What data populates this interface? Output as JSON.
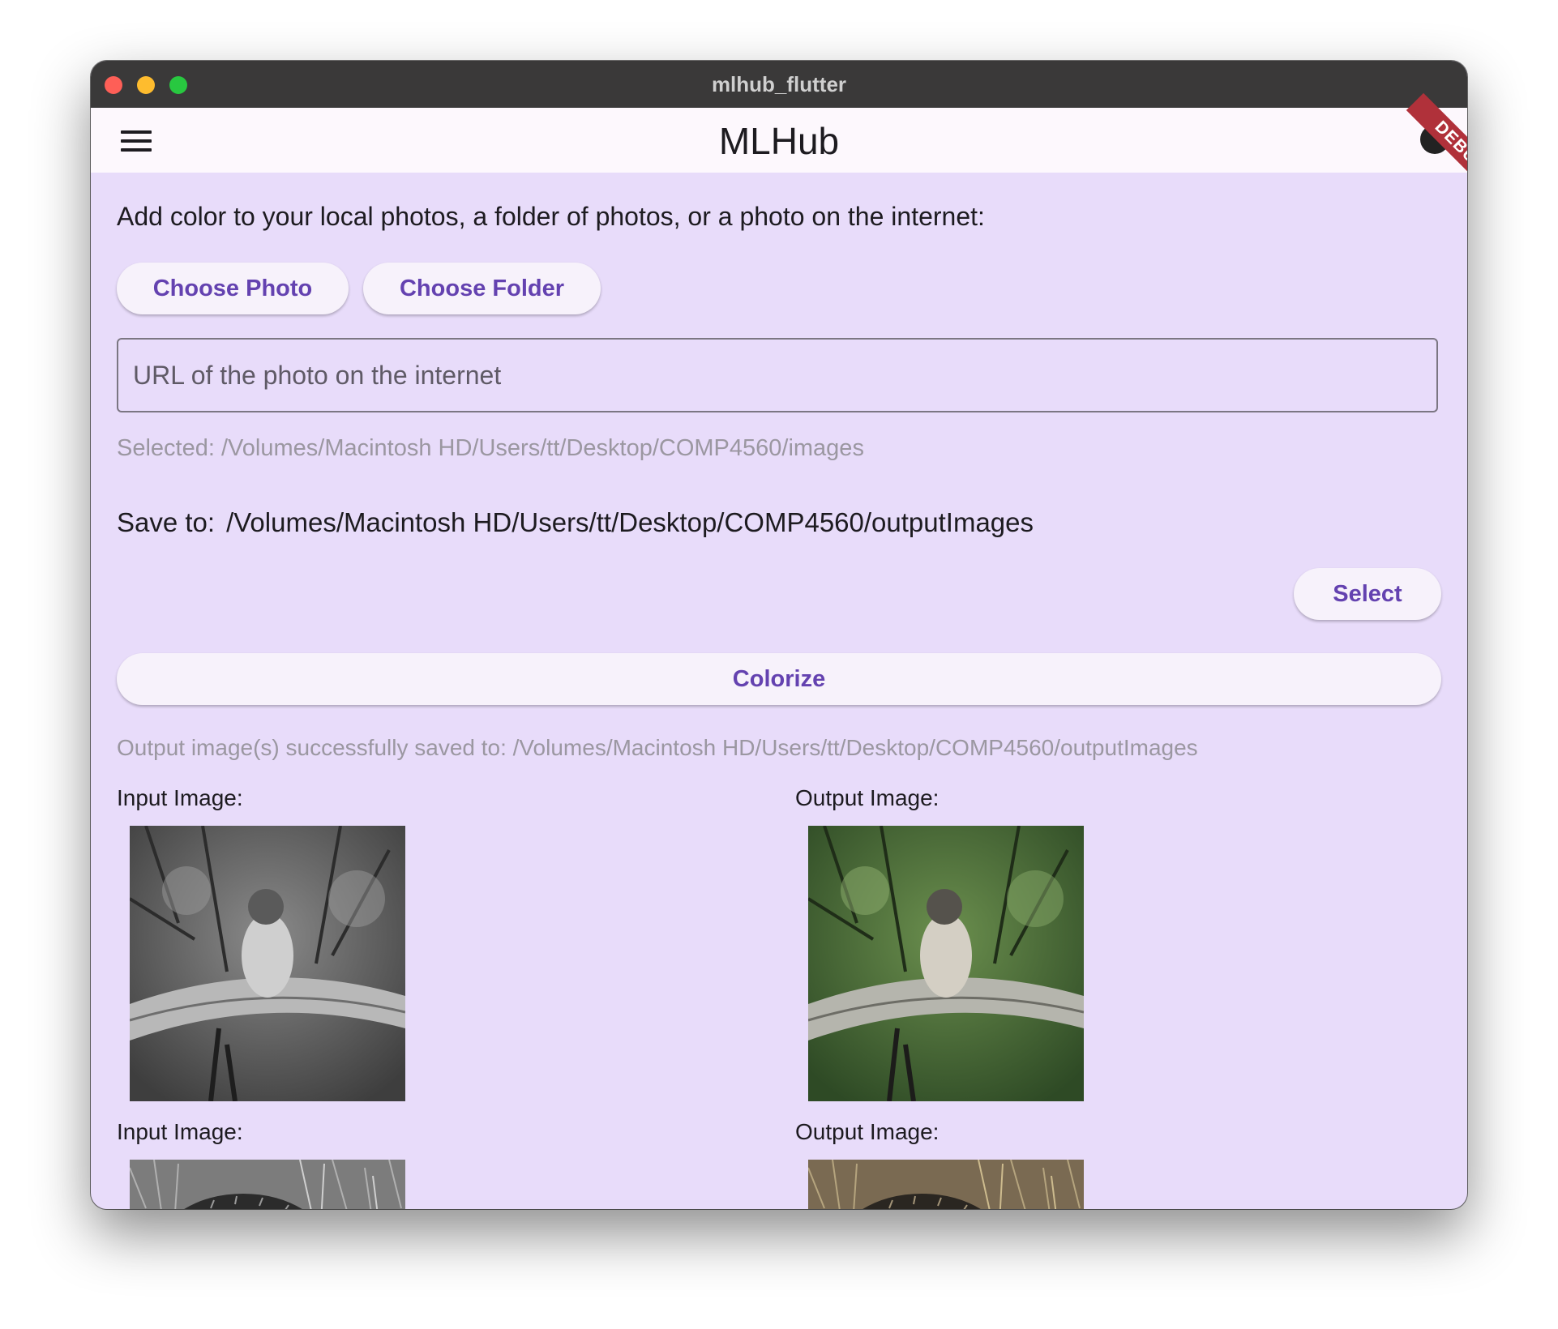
{
  "window": {
    "title": "mlhub_flutter"
  },
  "appbar": {
    "title": "MLHub",
    "debug_banner": "DEBUG"
  },
  "main": {
    "intro": "Add color to your local photos, a folder of photos, or a photo on the internet:",
    "choose_photo_label": "Choose Photo",
    "choose_folder_label": "Choose Folder",
    "url_placeholder": "URL of the photo on the internet",
    "url_value": "",
    "selected_text": "Selected: /Volumes/Macintosh HD/Users/tt/Desktop/COMP4560/images",
    "save_to_label": "Save to:",
    "save_to_path": "/Volumes/Macintosh HD/Users/tt/Desktop/COMP4560/outputImages",
    "select_label": "Select",
    "colorize_label": "Colorize",
    "success_text": "Output image(s) successfully saved to: /Volumes/Macintosh HD/Users/tt/Desktop/COMP4560/outputImages"
  },
  "results": [
    {
      "input_label": "Input Image:",
      "output_label": "Output Image:"
    },
    {
      "input_label": "Input Image:",
      "output_label": "Output Image:"
    }
  ],
  "colors": {
    "background": "#e8dcfa",
    "appbar": "#fdf8fd",
    "accent": "#6442b0",
    "titlebar": "#3a3939",
    "debug_banner": "#b0313a"
  },
  "icons": {
    "menu": "hamburger-menu-icon",
    "info": "info-icon"
  }
}
